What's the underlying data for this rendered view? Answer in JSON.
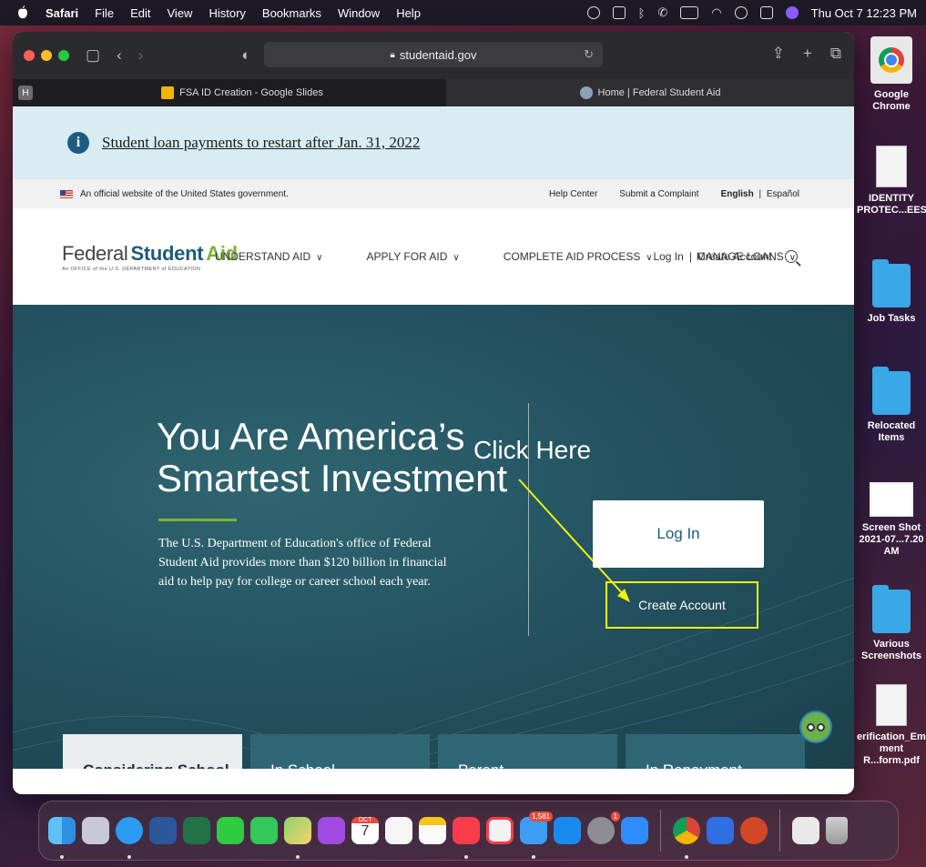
{
  "menubar": {
    "app": "Safari",
    "items": [
      "File",
      "Edit",
      "View",
      "History",
      "Bookmarks",
      "Window",
      "Help"
    ],
    "clock": "Thu Oct 7  12:23 PM"
  },
  "browser": {
    "url": "studentaid.gov",
    "pinned_tab": "H",
    "tabs": [
      {
        "title": "FSA ID Creation - Google Slides",
        "active": true
      },
      {
        "title": "Home | Federal Student Aid",
        "active": false
      }
    ]
  },
  "page": {
    "alert": "Student loan payments to restart after Jan. 31, 2022",
    "gov_banner": "An official website of the United States government.",
    "gov_links": {
      "help": "Help Center",
      "complaint": "Submit a Complaint",
      "lang_en": "English",
      "lang_sep": "|",
      "lang_es": "Español"
    },
    "logo": {
      "federal": "Federal",
      "student": "Student",
      "aid": "Aid",
      "sub": "An OFFICE of the U.S. DEPARTMENT of EDUCATION"
    },
    "nav": [
      "UNDERSTAND AID",
      "APPLY FOR AID",
      "COMPLETE AID PROCESS",
      "MANAGE LOANS"
    ],
    "nav_login": "Log In",
    "nav_sep": "|",
    "nav_create": "Create Account",
    "hero": {
      "title_line1": "You Are America’s",
      "title_line2": "Smartest Investment",
      "text": "The U.S. Department of Education's office of Federal Student Aid provides more than $120 billion in financial aid to help pay for college or career school each year.",
      "annotation": "Click Here",
      "login_button": "Log In",
      "create_button": "Create Account"
    },
    "cards": [
      "Considering School",
      "In School",
      "Parent",
      "In Repayment"
    ]
  },
  "desktop": [
    {
      "label": "Google Chrome",
      "icon": "chrome-icon"
    },
    {
      "label": "IDENTITY PROTEC...EES.pdf",
      "icon": "pdf-icon"
    },
    {
      "label": "Job Tasks",
      "icon": "folder-icon"
    },
    {
      "label": "Relocated Items",
      "icon": "folder-icon"
    },
    {
      "label": "Screen Shot 2021-07...7.20 AM",
      "icon": "screenshot-icon"
    },
    {
      "label": "Various Screenshots",
      "icon": "folder-icon"
    },
    {
      "label": "erification_Emplo ment R...form.pdf",
      "icon": "pdf-icon"
    }
  ],
  "dock": {
    "mail_badge": "1,581",
    "settings_badge": "1",
    "calendar_month": "OCT",
    "calendar_day": "7"
  },
  "colors": {
    "accent_green": "#7bb331",
    "brand_blue": "#1e5a7a",
    "highlight_yellow": "#f2f20a",
    "hero_teal": "#245361"
  }
}
